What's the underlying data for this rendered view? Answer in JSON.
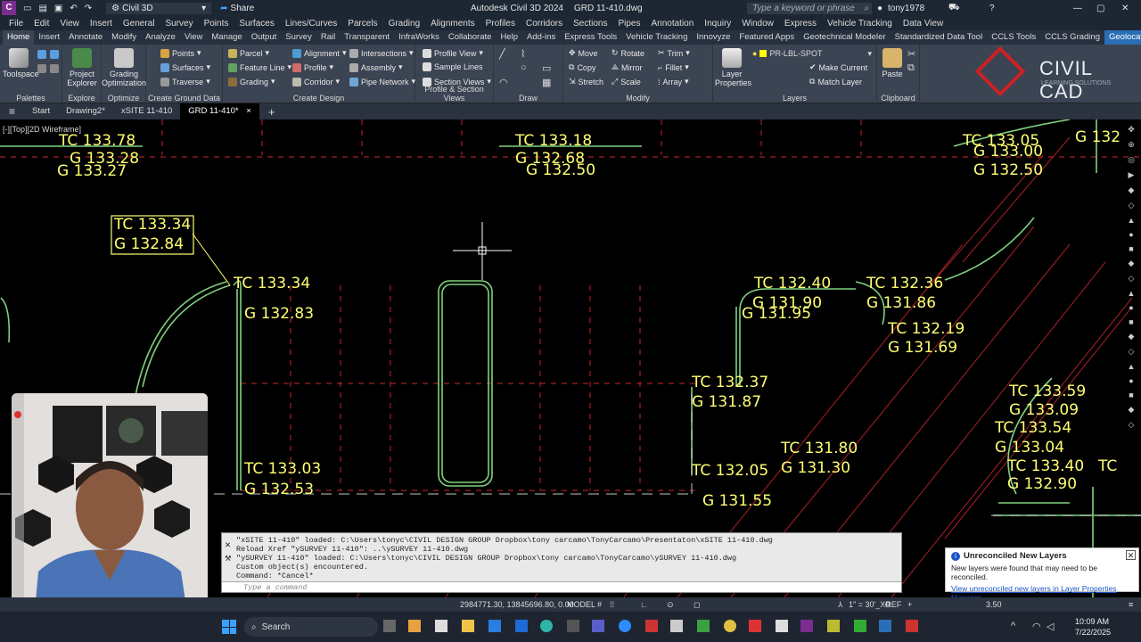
{
  "titlebar": {
    "app_letter": "C",
    "workspace": "Civil 3D",
    "share": "Share",
    "title": "Autodesk Civil 3D 2024",
    "file": "GRD 11-410.dwg",
    "search_placeholder": "Type a keyword or phrase",
    "user": "tony1978"
  },
  "menu": [
    "File",
    "Edit",
    "View",
    "Insert",
    "General",
    "Survey",
    "Points",
    "Surfaces",
    "Lines/Curves",
    "Parcels",
    "Grading",
    "Alignments",
    "Profiles",
    "Corridors",
    "Sections",
    "Pipes",
    "Annotation",
    "Inquiry",
    "Window",
    "Express",
    "Vehicle Tracking",
    "Data View"
  ],
  "ribbon_tabs": [
    "Home",
    "Insert",
    "Annotate",
    "Modify",
    "Analyze",
    "View",
    "Manage",
    "Output",
    "Survey",
    "Rail",
    "Transparent",
    "InfraWorks",
    "Collaborate",
    "Help",
    "Add-ins",
    "Express Tools",
    "Vehicle Tracking",
    "Innovyze",
    "Featured Apps",
    "Geotechnical Modeler",
    "Standardized Data Tool",
    "CCLS Tools",
    "CCLS Grading",
    "Geolocation"
  ],
  "ribbon": {
    "toolspace": "Toolspace",
    "project_explorer": "Project Explorer",
    "grading_optimization": "Grading Optimization",
    "points": "Points",
    "surfaces": "Surfaces",
    "traverse": "Traverse",
    "parcel": "Parcel",
    "feature_line": "Feature Line",
    "grading": "Grading",
    "alignment": "Alignment",
    "profile": "Profile",
    "corridor": "Corridor",
    "intersections": "Intersections",
    "assembly": "Assembly",
    "pipe_network": "Pipe Network",
    "profile_view": "Profile View",
    "sample_lines": "Sample Lines",
    "section_views": "Section Views",
    "move": "Move",
    "copy": "Copy",
    "stretch": "Stretch",
    "rotate": "Rotate",
    "mirror": "Mirror",
    "scale": "Scale",
    "trim": "Trim",
    "fillet": "Fillet",
    "array": "Array",
    "layer_properties": "Layer Properties",
    "layer_name": "PR-LBL-SPOT",
    "make_current": "Make Current",
    "match_layer": "Match Layer",
    "paste": "Paste",
    "logo_main": "CIVIL CAD",
    "logo_sub": "LEARNING SOLUTIONS",
    "panels": [
      "Palettes",
      "Explore",
      "Optimize",
      "Create Ground Data",
      "Create Design",
      "Profile & Section Views",
      "Draw",
      "Modify",
      "Layers",
      "Clipboard"
    ]
  },
  "doc_tabs": {
    "start": "Start",
    "tabs": [
      "Drawing2*",
      "xSITE 11-410",
      "GRD 11-410*"
    ],
    "close": "×",
    "add": "+"
  },
  "viewport": {
    "label": "[-][Top][2D Wireframe]",
    "spot_labels": [
      "TC 133.78",
      "G 133.28",
      "G 133.27",
      "TC 133.34",
      "G 132.84",
      "TC 133.34",
      "G 132.83",
      "TC 133.03",
      "G 132.53",
      "TC 133.18",
      "G 132.68",
      "G 132.50",
      "TC 133.05",
      "G 133.00",
      "G 132.50",
      "G 132",
      "TC 132.40",
      "G 131.90",
      "G 131.95",
      "TC 132.36",
      "G 131.86",
      "TC 132.19",
      "G 131.69",
      "TC 132.37",
      "G 131.87",
      "TC 131.80",
      "G 131.30",
      "TC 132.05",
      "G 131.55",
      "TC 133.59",
      "G 133.09",
      "TC 133.54",
      "G 133.04",
      "TC 133.40",
      "G 132.90",
      "TC"
    ]
  },
  "command": {
    "lines": [
      "\"xSITE 11-410\" loaded: C:\\Users\\tonyc\\CIVIL DESIGN GROUP Dropbox\\tony carcamo\\TonyCarcamo\\Presentaton\\xSITE 11-410.dwg",
      "Reload Xref \"ySURVEY 11-410\": ..\\ySURVEY 11-410.dwg",
      "\"ySURVEY 11-410\" loaded: C:\\Users\\tonyc\\CIVIL DESIGN GROUP Dropbox\\tony carcamo\\TonyCarcamo\\ySURVEY 11-410.dwg",
      "Custom object(s) encountered.",
      "Command: *Cancel*"
    ],
    "placeholder": "Type a command"
  },
  "notification": {
    "title": "Unreconciled New Layers",
    "body": "New layers were found that may need to be reconciled.",
    "link": "View unreconciled new layers in Layer Properties Manager"
  },
  "status": {
    "coords": "2984771.30, 13845696.80, 0.00",
    "model": "MODEL",
    "scale": "1\" = 30'_XREF",
    "lineweight": "3.50"
  },
  "taskbar": {
    "search": "Search",
    "time": "10:09 AM",
    "date": "7/22/2025"
  },
  "colors": {
    "canvas": "#000000",
    "label": "#ffff73",
    "green_line": "#7fd27f",
    "red_line": "#c2262e",
    "ribbon": "#3b4453",
    "accent": "#2a6fb5"
  }
}
